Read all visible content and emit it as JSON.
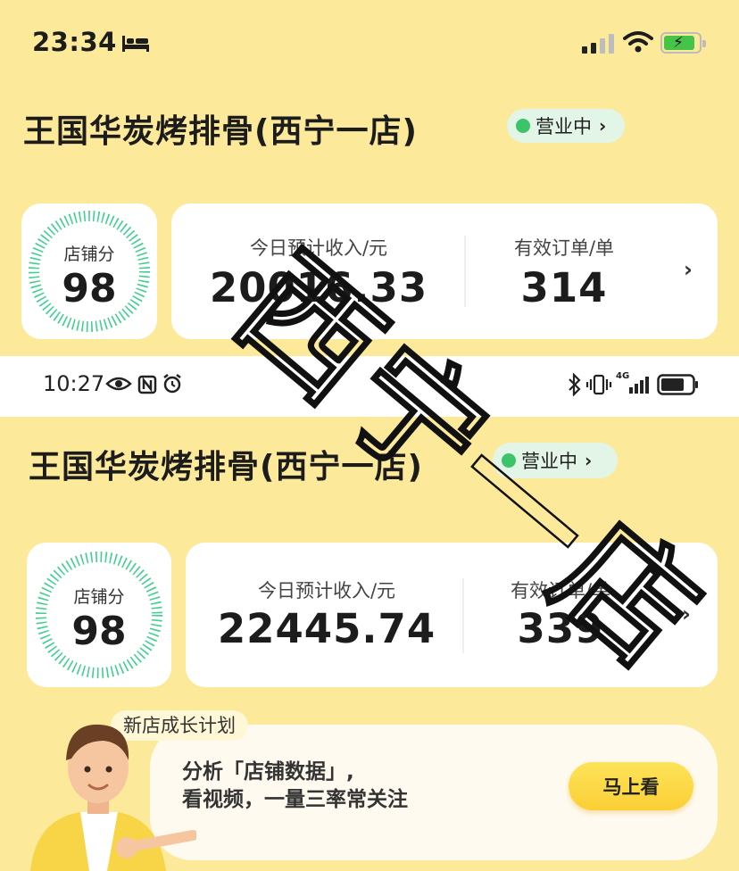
{
  "status_bar_1": {
    "time": "23:34",
    "icons": [
      "bed-icon",
      "cellular-signal-icon",
      "wifi-icon",
      "battery-charging-icon"
    ]
  },
  "screen_1": {
    "store_name": "王国华炭烤排骨(西宁一店)",
    "status_badge": "营业中",
    "score_label": "店铺分",
    "score_value": "98",
    "income_label": "今日预计收入/元",
    "income_value": "20016.33",
    "orders_label": "有效订单/单",
    "orders_value": "314"
  },
  "status_bar_2": {
    "time": "10:27",
    "network": "4G",
    "icons": [
      "eye-icon",
      "nfc-icon",
      "alarm-icon",
      "bluetooth-icon",
      "vibrate-icon",
      "cellular-signal-icon",
      "battery-icon"
    ]
  },
  "screen_2": {
    "store_name": "王国华炭烤排骨(西宁一店)",
    "status_badge": "营业中",
    "score_label": "店铺分",
    "score_value": "98",
    "income_label": "今日预计收入/元",
    "income_value": "22445.74",
    "orders_label": "有效订单/单",
    "orders_value": "339"
  },
  "promo": {
    "tag": "新店成长计划",
    "line1": "分析「店铺数据」,",
    "line2": "看视频，一量三率常关注",
    "button": "马上看"
  },
  "watermark": {
    "text": "西宁一店"
  },
  "colors": {
    "background": "#fde99a",
    "open_dot": "#3cc46a",
    "badge_bg": "#e3f5e6",
    "gauge": "#3fcf8e",
    "button": "#fbd43f"
  }
}
